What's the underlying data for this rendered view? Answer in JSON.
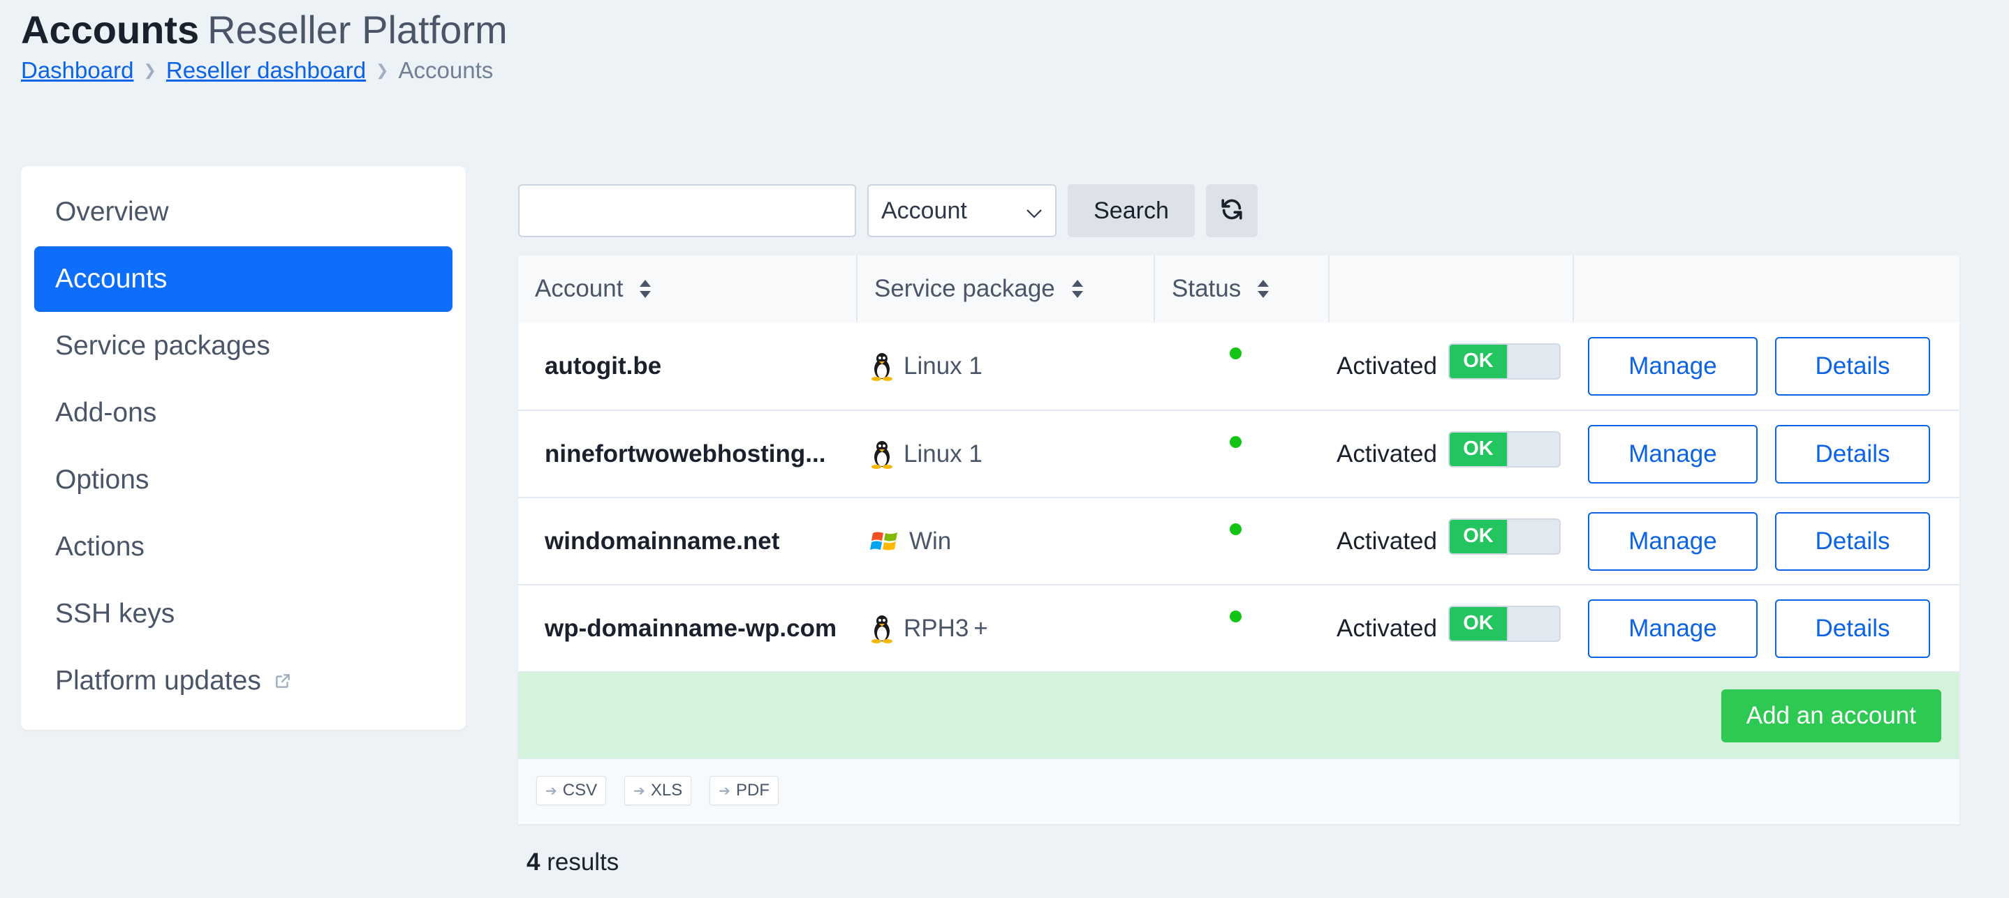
{
  "header": {
    "title_main": "Accounts",
    "title_sub": "Reseller Platform"
  },
  "breadcrumb": {
    "items": [
      "Dashboard",
      "Reseller dashboard"
    ],
    "current": "Accounts"
  },
  "sidebar": {
    "items": [
      {
        "label": "Overview"
      },
      {
        "label": "Accounts",
        "active": true
      },
      {
        "label": "Service packages"
      },
      {
        "label": "Add-ons"
      },
      {
        "label": "Options"
      },
      {
        "label": "Actions"
      },
      {
        "label": "SSH keys"
      },
      {
        "label": "Platform updates",
        "icon": "external-link-icon"
      }
    ]
  },
  "toolbar": {
    "search_value": "",
    "search_placeholder": "",
    "filter_selected": "Account",
    "search_label": "Search",
    "refresh_icon": "refresh-icon"
  },
  "table": {
    "columns": [
      "Account",
      "Service package",
      "Status",
      "",
      ""
    ],
    "rows": [
      {
        "account": "autogit.be",
        "package": "Linux 1",
        "package_icon": "linux-icon",
        "status": "Activated",
        "toggle": "OK",
        "manage": "Manage",
        "details": "Details"
      },
      {
        "account": "ninefortwowebhosting...",
        "package": "Linux 1",
        "package_icon": "linux-icon",
        "status": "Activated",
        "toggle": "OK",
        "manage": "Manage",
        "details": "Details"
      },
      {
        "account": "windomainname.net",
        "package": "Win",
        "package_icon": "windows-icon",
        "status": "Activated",
        "toggle": "OK",
        "manage": "Manage",
        "details": "Details"
      },
      {
        "account": "wp-domainname-wp.com",
        "package": "RPH3 +",
        "package_icon": "linux-icon",
        "status": "Activated",
        "toggle": "OK",
        "manage": "Manage",
        "details": "Details"
      }
    ],
    "add_label": "Add an account",
    "exports": [
      "CSV",
      "XLS",
      "PDF"
    ]
  },
  "results": {
    "count": "4",
    "label": "results"
  },
  "colors": {
    "accent": "#0d6efd",
    "link": "#0b63e5",
    "success": "#2ec952",
    "status_dot": "#14c414",
    "add_row_bg": "#d4f2dc",
    "page_bg": "#edf2f7"
  }
}
